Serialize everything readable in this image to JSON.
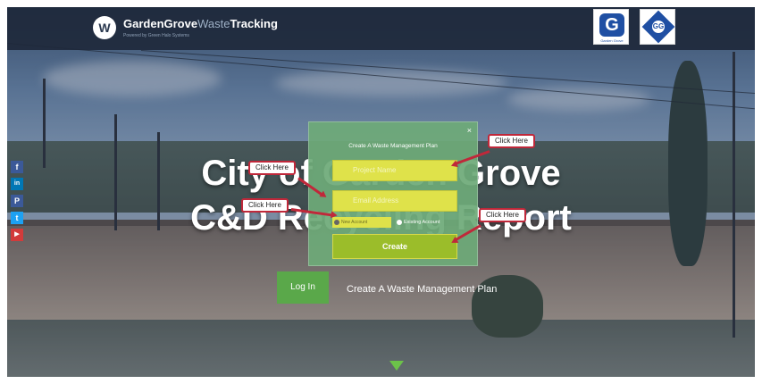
{
  "header": {
    "logo_text": "W",
    "brand_primary": "GardenGrove",
    "brand_secondary": "Waste",
    "brand_tertiary": "Tracking",
    "tagline": "Powered by Green Halo Systems",
    "badge_g": "G",
    "badge_g_caption": "Garden Grove",
    "badge_seal": "GG"
  },
  "social": [
    {
      "icon": "facebook-icon",
      "glyph": "f",
      "color": "#3b5998"
    },
    {
      "icon": "linkedin-icon",
      "glyph": "in",
      "color": "#0077b5"
    },
    {
      "icon": "pinterest-icon",
      "glyph": "P",
      "color": "#3b5998"
    },
    {
      "icon": "twitter-icon",
      "glyph": "t",
      "color": "#1da1f2"
    },
    {
      "icon": "youtube-icon",
      "glyph": "▶",
      "color": "#d23b3b"
    }
  ],
  "hero": {
    "line1": "City of Garden Grove",
    "line2": "C&D Recycling Report"
  },
  "actions": {
    "login_label": "Log In",
    "create_plan_label": "Create A Waste Management Plan"
  },
  "modal": {
    "title": "Create A Waste Management Plan",
    "close": "×",
    "field1_placeholder": "Project Name",
    "field2_placeholder": "Email Address",
    "radio_new": "New Account",
    "radio_existing": "Existing Account",
    "create_label": "Create"
  },
  "callouts": {
    "c1": "Click Here",
    "c2": "Click Here",
    "c3": "Click Here",
    "c4": "Click Here"
  },
  "colors": {
    "accent_green": "#5aa84a",
    "field_yellow": "#dfe24a",
    "callout_red": "#c0283a",
    "header_bg": "#1e283a"
  }
}
